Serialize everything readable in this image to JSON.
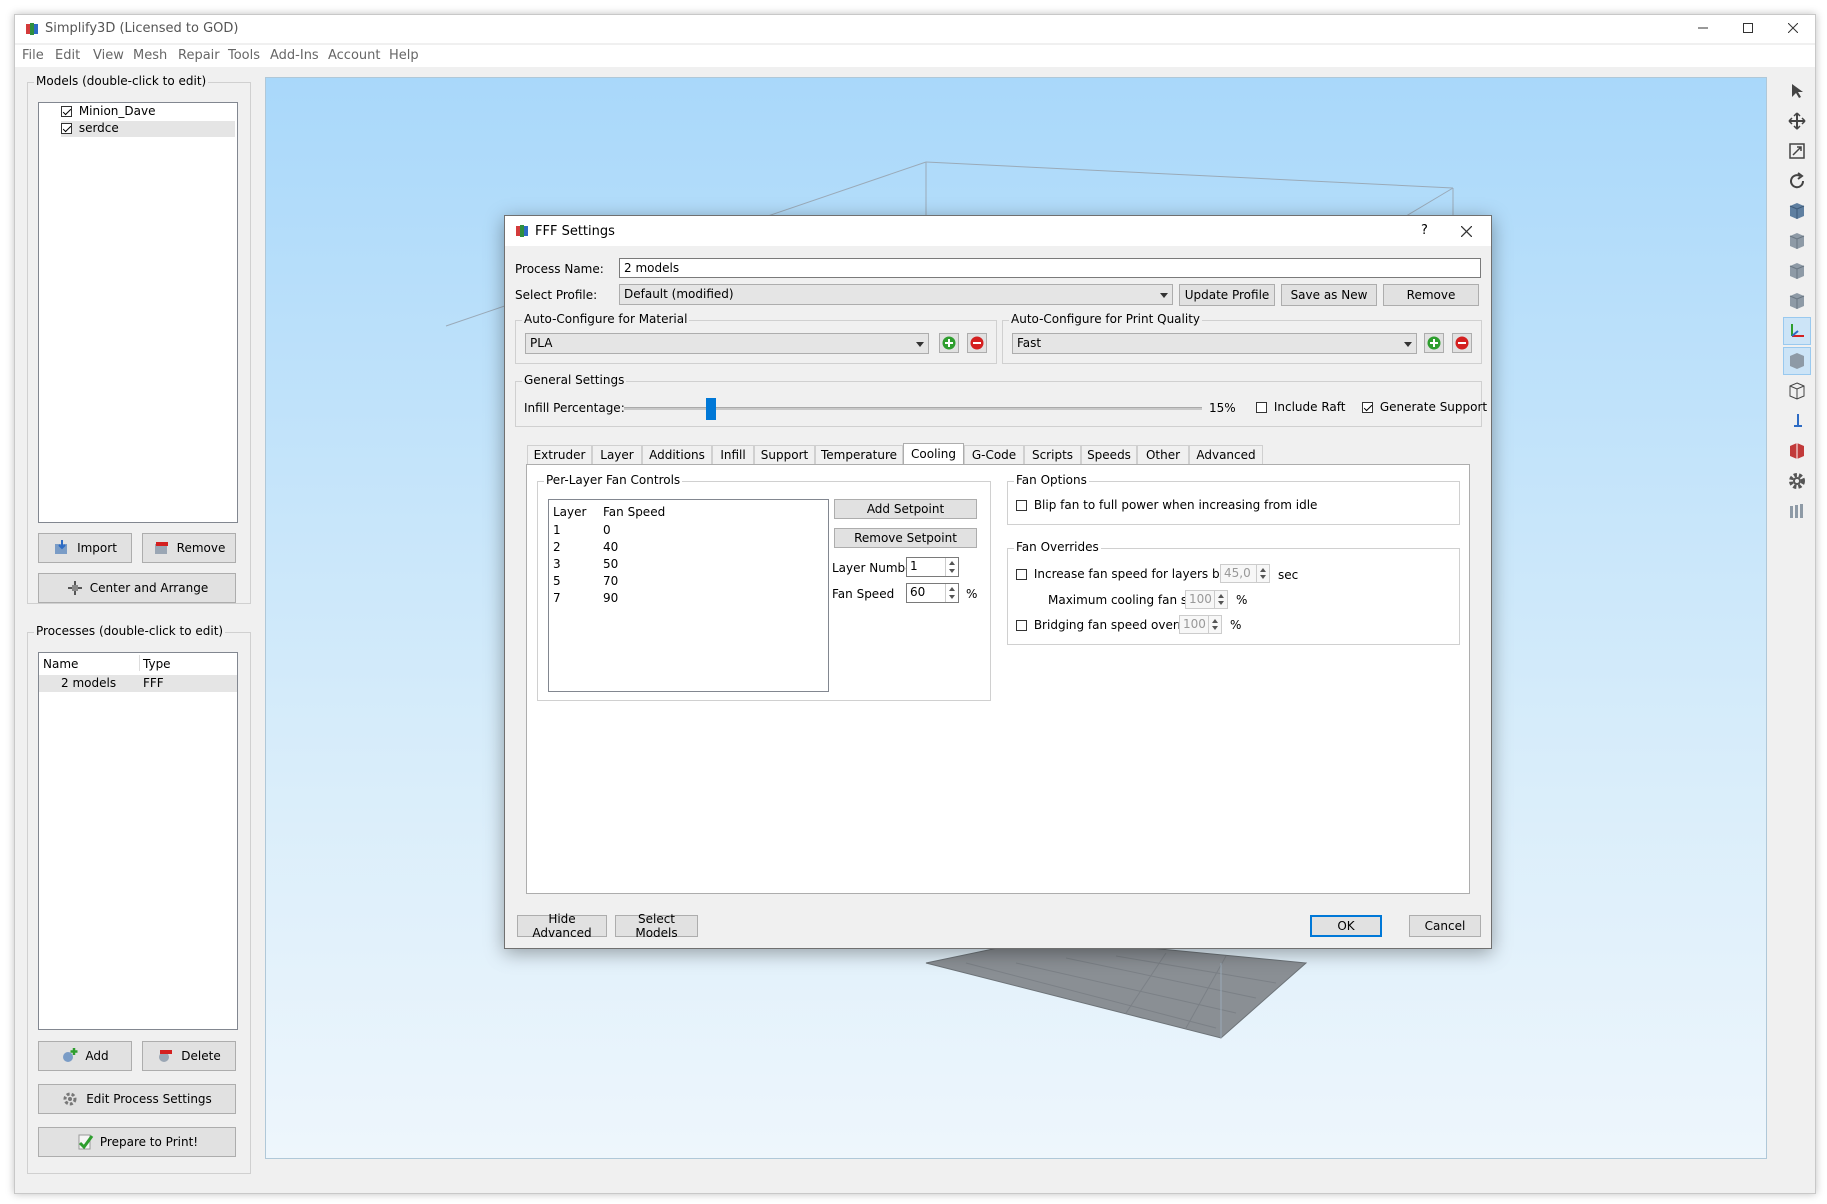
{
  "app": {
    "title": "Simplify3D (Licensed to GOD)",
    "menu": [
      "File",
      "Edit",
      "View",
      "Mesh",
      "Repair",
      "Tools",
      "Add-Ins",
      "Account",
      "Help"
    ]
  },
  "models_panel": {
    "title": "Models (double-click to edit)",
    "items": [
      {
        "label": "Minion_Dave",
        "checked": true
      },
      {
        "label": "serdce",
        "checked": true
      }
    ],
    "import_label": "Import",
    "remove_label": "Remove",
    "center_label": "Center and Arrange"
  },
  "processes_panel": {
    "title": "Processes (double-click to edit)",
    "col_name": "Name",
    "col_type": "Type",
    "rows": [
      {
        "name": "2 models",
        "type": "FFF"
      }
    ],
    "add_label": "Add",
    "delete_label": "Delete",
    "edit_label": "Edit Process Settings",
    "prepare_label": "Prepare to Print!"
  },
  "dialog": {
    "title": "FFF Settings",
    "help": "?",
    "process_name_label": "Process Name:",
    "process_name_value": "2 models",
    "select_profile_label": "Select Profile:",
    "profile_value": "Default (modified)",
    "update_profile": "Update Profile",
    "save_as_new": "Save as New",
    "remove": "Remove",
    "material_group": "Auto-Configure for Material",
    "material_value": "PLA",
    "quality_group": "Auto-Configure for Print Quality",
    "quality_value": "Fast",
    "general_group": "General Settings",
    "infill_label": "Infill Percentage:",
    "infill_value": "15%",
    "infill_fraction": 0.15,
    "include_raft": "Include Raft",
    "include_raft_checked": false,
    "generate_support": "Generate Support",
    "generate_support_checked": true,
    "tabs": [
      "Extruder",
      "Layer",
      "Additions",
      "Infill",
      "Support",
      "Temperature",
      "Cooling",
      "G-Code",
      "Scripts",
      "Speeds",
      "Other",
      "Advanced"
    ],
    "active_tab": "Cooling",
    "per_layer_group": "Per-Layer Fan Controls",
    "col_layer": "Layer",
    "col_fan_speed": "Fan Speed",
    "fan_rows": [
      {
        "layer": "1",
        "speed": "0"
      },
      {
        "layer": "2",
        "speed": "40"
      },
      {
        "layer": "3",
        "speed": "50"
      },
      {
        "layer": "5",
        "speed": "70"
      },
      {
        "layer": "7",
        "speed": "90"
      }
    ],
    "add_setpoint": "Add Setpoint",
    "remove_setpoint": "Remove Setpoint",
    "layer_number_label": "Layer Number",
    "layer_number_value": "1",
    "fan_speed_label": "Fan Speed",
    "fan_speed_value": "60",
    "percent": "%",
    "fan_options_group": "Fan Options",
    "blip_fan": "Blip fan to full power when increasing from idle",
    "fan_overrides_group": "Fan Overrides",
    "increase_fan": "Increase fan speed for layers below",
    "increase_value": "45,0",
    "sec": "sec",
    "max_cooling": "Maximum cooling fan speed",
    "max_cooling_value": "100",
    "bridging": "Bridging fan speed override",
    "bridging_value": "100",
    "hide_advanced": "Hide Advanced",
    "select_models": "Select Models",
    "ok": "OK",
    "cancel": "Cancel"
  },
  "colors": {
    "accent": "#0078d7",
    "viewport_top": "#a9d8fa",
    "add_green": "#2e9e2e",
    "remove_red": "#d42020"
  }
}
